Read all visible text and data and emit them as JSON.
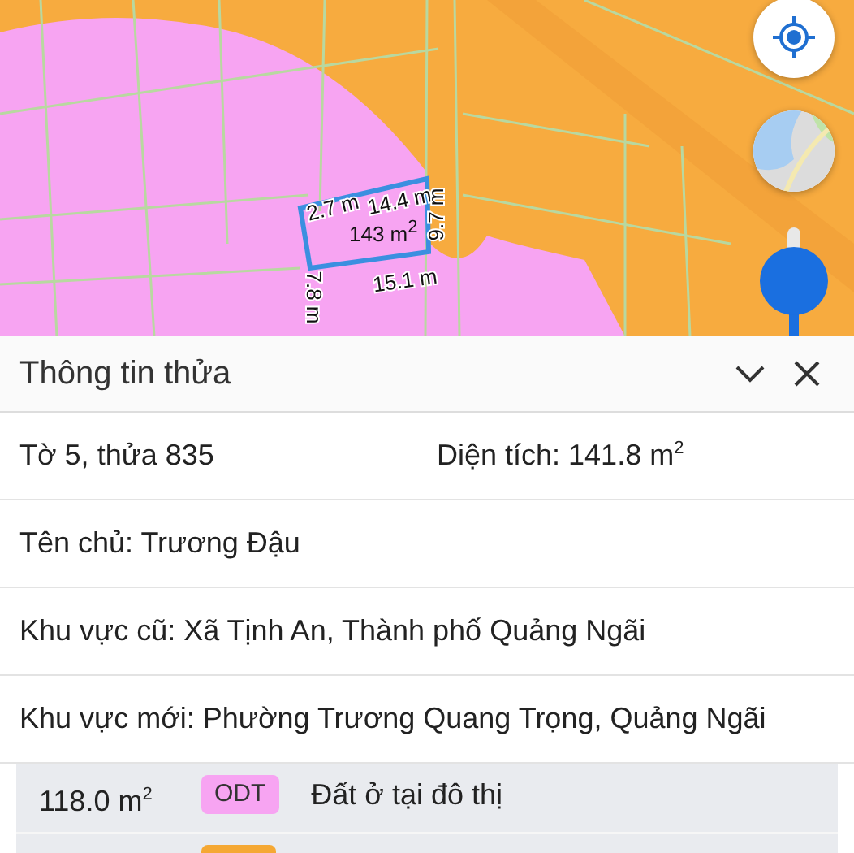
{
  "map": {
    "parcel": {
      "area": "143 m$^{2}$",
      "edges": [
        {
          "label": "2.7 m"
        },
        {
          "label": "14.4 m"
        },
        {
          "label": "9.7 m"
        },
        {
          "label": "15.1 m"
        },
        {
          "label": "7.8 m"
        }
      ]
    }
  },
  "panel": {
    "title": "Thông tin thửa",
    "rows": [
      {
        "kind": "pair",
        "left": "Tờ 5, thửa 835",
        "right": "Diện tích: 141.8 m$^{2}$"
      },
      {
        "kind": "single",
        "text": "Tên chủ: Trương Đậu"
      },
      {
        "kind": "single",
        "text": "Khu vực cũ: Xã Tịnh An, Thành phố Quảng Ngãi"
      },
      {
        "kind": "single",
        "text": "Khu vực mới: Phường Trương Quang Trọng, Quảng Ngãi"
      }
    ],
    "land_uses": [
      {
        "area": "118.0 m$^{2}$",
        "code": "ODT",
        "color": "#f7a4f2",
        "description": "Đất ở tại đô thị"
      },
      {
        "color": "#f5a833"
      }
    ]
  }
}
